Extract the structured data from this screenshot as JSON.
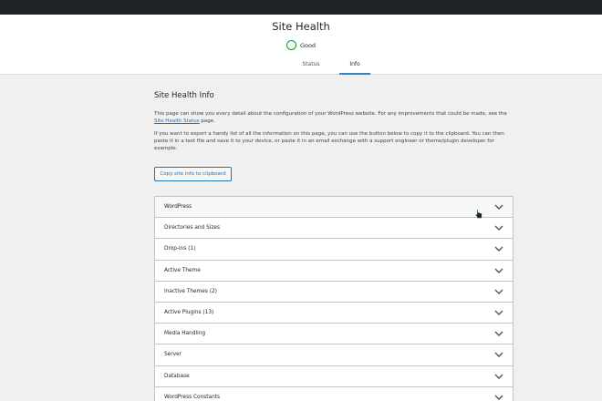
{
  "header": {
    "title": "Site Health",
    "status": "Good"
  },
  "tabs": [
    {
      "label": "Status",
      "active": false
    },
    {
      "label": "Info",
      "active": true
    }
  ],
  "info": {
    "section_title": "Site Health Info",
    "para1_text": "This page can show you every detail about the configuration of your WordPress website. For any improvements that could be made, see the",
    "para1_link": "Site Health Status",
    "para1_suffix": "page.",
    "para2": "If you want to export a handy list of all the information on this page, you can use the button below to copy it to the clipboard. You can then paste it in a text file and save it to your device, or paste it in an email exchange with a support engineer or theme/plugin developer for example.",
    "copy_button": "Copy site info to clipboard"
  },
  "accordion": [
    {
      "label": "WordPress"
    },
    {
      "label": "Directories and Sizes"
    },
    {
      "label": "Drop-ins (1)"
    },
    {
      "label": "Active Theme"
    },
    {
      "label": "Inactive Themes (2)"
    },
    {
      "label": "Active Plugins (13)"
    },
    {
      "label": "Media Handling"
    },
    {
      "label": "Server"
    },
    {
      "label": "Database"
    },
    {
      "label": "WordPress Constants"
    }
  ],
  "colors": {
    "accent": "#2271b1",
    "good": "#00a32a",
    "adminbar": "#1d2327"
  }
}
